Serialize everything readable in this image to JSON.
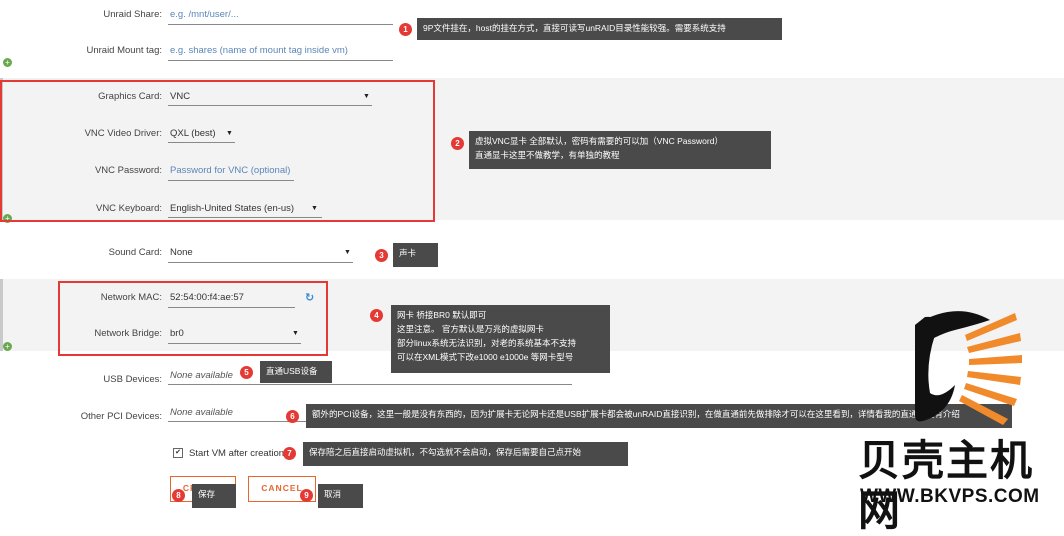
{
  "share": {
    "label": "Unraid Share:",
    "placeholder": "e.g. /mnt/user/...",
    "mount_label": "Unraid Mount tag:",
    "mount_placeholder": "e.g. shares (name of mount tag inside vm)"
  },
  "graphics": {
    "card_label": "Graphics Card:",
    "card_value": "VNC",
    "driver_label": "VNC Video Driver:",
    "driver_value": "QXL (best)",
    "password_label": "VNC Password:",
    "password_placeholder": "Password for VNC (optional)",
    "keyboard_label": "VNC Keyboard:",
    "keyboard_value": "English-United States (en-us)"
  },
  "sound": {
    "label": "Sound Card:",
    "value": "None"
  },
  "network": {
    "mac_label": "Network MAC:",
    "mac_value": "52:54:00:f4:ae:57",
    "bridge_label": "Network Bridge:",
    "bridge_value": "br0"
  },
  "usb": {
    "label": "USB Devices:",
    "value": "None available"
  },
  "pci": {
    "label": "Other PCI Devices:",
    "value": "None available"
  },
  "start_vm": {
    "label": "Start VM after creation",
    "checked": true
  },
  "buttons": {
    "create": "CREATE",
    "cancel": "CANCEL"
  },
  "annotations": [
    {
      "num": "1",
      "text": "9P文件挂在，host的挂在方式，直接可读写unRAID目录性能较强。需要系统支持"
    },
    {
      "num": "2",
      "line1": "虚拟VNC显卡 全部默认，密码有需要的可以加（VNC Password）",
      "line2": "直通显卡这里不做教学，有单独的教程"
    },
    {
      "num": "3",
      "text": "声卡"
    },
    {
      "num": "4",
      "line1": "网卡 桥接BR0 默认即可",
      "line2": "这里注意。 官方默认是万兆的虚拟网卡",
      "line3": "部分linux系统无法识别，对老的系统基本不支持",
      "line4": "可以在XML模式下改e1000 e1000e 等网卡型号"
    },
    {
      "num": "5",
      "text": "直通USB设备"
    },
    {
      "num": "6",
      "text": "额外的PCI设备，这里一般是没有东西的，因为扩展卡无论网卡还是USB扩展卡都会被unRAID直接识别，在做直通前先做排除才可以在这里看到，详情看我的直通教程有介绍"
    },
    {
      "num": "7",
      "text": "保存陪之后直接启动虚拟机，不勾选就不会启动，保存后需要自己点开始"
    },
    {
      "num": "8",
      "text": "保存"
    },
    {
      "num": "9",
      "text": "取消"
    }
  ],
  "watermark": {
    "cn": "贝壳主机网",
    "url": "WWW.BKVPS.COM"
  },
  "colors": {
    "accent": "#e6662e",
    "annotation": "#e53935",
    "tooltip": "#4a4a4a",
    "placeholder": "#5b86b8"
  }
}
